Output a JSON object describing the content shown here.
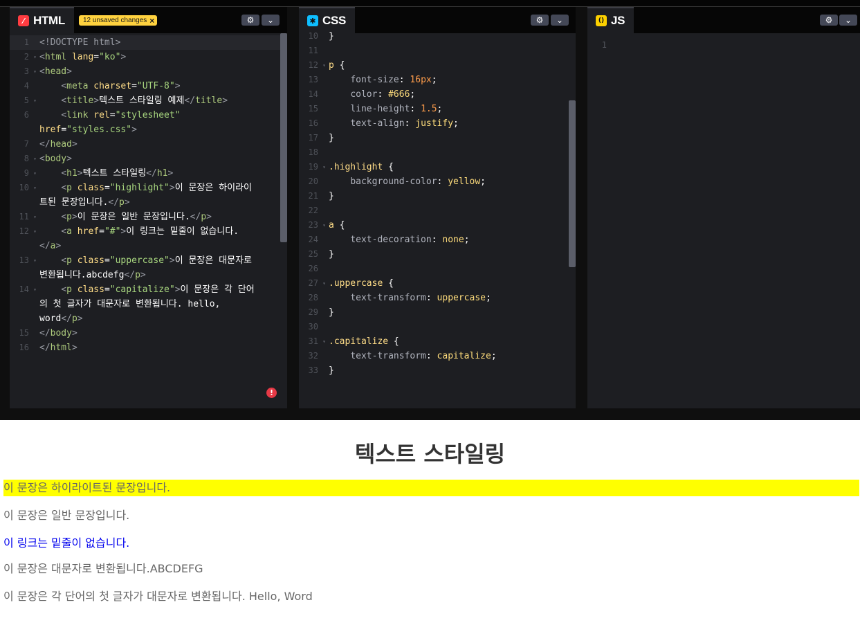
{
  "html_panel": {
    "tab_label": "HTML",
    "tab_icon": "slash-icon",
    "tab_color": "#ff3c41",
    "unsaved_badge": "12 unsaved changes",
    "lines": [
      {
        "n": "1",
        "fold": false,
        "segs": [
          [
            "br",
            "<!DOCTYPE html>"
          ]
        ]
      },
      {
        "n": "2",
        "fold": true,
        "segs": [
          [
            "br",
            "<"
          ],
          [
            "tg",
            "html"
          ],
          [
            "wt",
            " "
          ],
          [
            "at",
            "lang"
          ],
          [
            "wt",
            "="
          ],
          [
            "st",
            "\"ko\""
          ],
          [
            "br",
            ">"
          ]
        ]
      },
      {
        "n": "3",
        "fold": true,
        "segs": [
          [
            "br",
            "<"
          ],
          [
            "tg",
            "head"
          ],
          [
            "br",
            ">"
          ]
        ]
      },
      {
        "n": "4",
        "fold": false,
        "segs": [
          [
            "wt",
            "    "
          ],
          [
            "br",
            "<"
          ],
          [
            "tg",
            "meta"
          ],
          [
            "wt",
            " "
          ],
          [
            "at",
            "charset"
          ],
          [
            "wt",
            "="
          ],
          [
            "st",
            "\"UTF-8\""
          ],
          [
            "br",
            ">"
          ]
        ]
      },
      {
        "n": "5",
        "fold": true,
        "segs": [
          [
            "wt",
            "    "
          ],
          [
            "br",
            "<"
          ],
          [
            "tg",
            "title"
          ],
          [
            "br",
            ">"
          ],
          [
            "wt",
            "텍스트 스타일링 예제"
          ],
          [
            "br",
            "</"
          ],
          [
            "tg",
            "title"
          ],
          [
            "br",
            ">"
          ]
        ]
      },
      {
        "n": "6",
        "fold": false,
        "segs": [
          [
            "wt",
            "    "
          ],
          [
            "br",
            "<"
          ],
          [
            "tg",
            "link"
          ],
          [
            "wt",
            " "
          ],
          [
            "at",
            "rel"
          ],
          [
            "wt",
            "="
          ],
          [
            "st",
            "\"stylesheet\""
          ]
        ]
      },
      {
        "n": "",
        "fold": false,
        "segs": [
          [
            "at",
            "href"
          ],
          [
            "wt",
            "="
          ],
          [
            "st",
            "\"styles.css\""
          ],
          [
            "br",
            ">"
          ]
        ]
      },
      {
        "n": "7",
        "fold": false,
        "segs": [
          [
            "br",
            "</"
          ],
          [
            "tg",
            "head"
          ],
          [
            "br",
            ">"
          ]
        ]
      },
      {
        "n": "8",
        "fold": true,
        "segs": [
          [
            "br",
            "<"
          ],
          [
            "tg",
            "body"
          ],
          [
            "br",
            ">"
          ]
        ]
      },
      {
        "n": "9",
        "fold": true,
        "segs": [
          [
            "wt",
            "    "
          ],
          [
            "br",
            "<"
          ],
          [
            "tg",
            "h1"
          ],
          [
            "br",
            ">"
          ],
          [
            "wt",
            "텍스트 스타일링"
          ],
          [
            "br",
            "</"
          ],
          [
            "tg",
            "h1"
          ],
          [
            "br",
            ">"
          ]
        ]
      },
      {
        "n": "10",
        "fold": true,
        "segs": [
          [
            "wt",
            "    "
          ],
          [
            "br",
            "<"
          ],
          [
            "tg",
            "p"
          ],
          [
            "wt",
            " "
          ],
          [
            "at",
            "class"
          ],
          [
            "wt",
            "="
          ],
          [
            "st",
            "\"highlight\""
          ],
          [
            "br",
            ">"
          ],
          [
            "wt",
            "이 문장은 하이라이"
          ]
        ]
      },
      {
        "n": "",
        "fold": false,
        "segs": [
          [
            "wt",
            "트된 문장입니다."
          ],
          [
            "br",
            "</"
          ],
          [
            "tg",
            "p"
          ],
          [
            "br",
            ">"
          ]
        ]
      },
      {
        "n": "11",
        "fold": true,
        "segs": [
          [
            "wt",
            "    "
          ],
          [
            "br",
            "<"
          ],
          [
            "tg",
            "p"
          ],
          [
            "br",
            ">"
          ],
          [
            "wt",
            "이 문장은 일반 문장입니다."
          ],
          [
            "br",
            "</"
          ],
          [
            "tg",
            "p"
          ],
          [
            "br",
            ">"
          ]
        ]
      },
      {
        "n": "12",
        "fold": true,
        "segs": [
          [
            "wt",
            "    "
          ],
          [
            "br",
            "<"
          ],
          [
            "tg",
            "a"
          ],
          [
            "wt",
            " "
          ],
          [
            "at",
            "href"
          ],
          [
            "wt",
            "="
          ],
          [
            "st",
            "\"#\""
          ],
          [
            "br",
            ">"
          ],
          [
            "wt",
            "이 링크는 밑줄이 없습니다."
          ]
        ]
      },
      {
        "n": "",
        "fold": false,
        "segs": [
          [
            "br",
            "</"
          ],
          [
            "tg",
            "a"
          ],
          [
            "br",
            ">"
          ]
        ]
      },
      {
        "n": "13",
        "fold": true,
        "segs": [
          [
            "wt",
            "    "
          ],
          [
            "br",
            "<"
          ],
          [
            "tg",
            "p"
          ],
          [
            "wt",
            " "
          ],
          [
            "at",
            "class"
          ],
          [
            "wt",
            "="
          ],
          [
            "st",
            "\"uppercase\""
          ],
          [
            "br",
            ">"
          ],
          [
            "wt",
            "이 문장은 대문자로"
          ]
        ]
      },
      {
        "n": "",
        "fold": false,
        "segs": [
          [
            "wt",
            "변환됩니다.abcdefg"
          ],
          [
            "br",
            "</"
          ],
          [
            "tg",
            "p"
          ],
          [
            "br",
            ">"
          ]
        ]
      },
      {
        "n": "14",
        "fold": true,
        "segs": [
          [
            "wt",
            "    "
          ],
          [
            "br",
            "<"
          ],
          [
            "tg",
            "p"
          ],
          [
            "wt",
            " "
          ],
          [
            "at",
            "class"
          ],
          [
            "wt",
            "="
          ],
          [
            "st",
            "\"capitalize\""
          ],
          [
            "br",
            ">"
          ],
          [
            "wt",
            "이 문장은 각 단어"
          ]
        ]
      },
      {
        "n": "",
        "fold": false,
        "segs": [
          [
            "wt",
            "의 첫 글자가 대문자로 변환됩니다. hello,"
          ]
        ]
      },
      {
        "n": "",
        "fold": false,
        "segs": [
          [
            "wt",
            "word"
          ],
          [
            "br",
            "</"
          ],
          [
            "tg",
            "p"
          ],
          [
            "br",
            ">"
          ]
        ]
      },
      {
        "n": "15",
        "fold": false,
        "segs": [
          [
            "br",
            "</"
          ],
          [
            "tg",
            "body"
          ],
          [
            "br",
            ">"
          ]
        ]
      },
      {
        "n": "16",
        "fold": false,
        "segs": [
          [
            "br",
            "</"
          ],
          [
            "tg",
            "html"
          ],
          [
            "br",
            ">"
          ]
        ]
      }
    ],
    "error_icon": "!"
  },
  "css_panel": {
    "tab_label": "CSS",
    "tab_icon": "asterisk-icon",
    "tab_color": "#0ebeff",
    "lines": [
      {
        "n": "10",
        "fold": false,
        "segs": [
          [
            "wt",
            "}"
          ]
        ]
      },
      {
        "n": "11",
        "fold": false,
        "segs": []
      },
      {
        "n": "12",
        "fold": true,
        "segs": [
          [
            "sel",
            "p"
          ],
          [
            "wt",
            " {"
          ]
        ]
      },
      {
        "n": "13",
        "fold": false,
        "segs": [
          [
            "wt",
            "    "
          ],
          [
            "pr",
            "font-size"
          ],
          [
            "wt",
            ": "
          ],
          [
            "nm",
            "16px"
          ],
          [
            "wt",
            ";"
          ]
        ]
      },
      {
        "n": "14",
        "fold": false,
        "segs": [
          [
            "wt",
            "    "
          ],
          [
            "pr",
            "color"
          ],
          [
            "wt",
            ": "
          ],
          [
            "vl",
            "#666"
          ],
          [
            "wt",
            ";"
          ]
        ]
      },
      {
        "n": "15",
        "fold": false,
        "segs": [
          [
            "wt",
            "    "
          ],
          [
            "pr",
            "line-height"
          ],
          [
            "wt",
            ": "
          ],
          [
            "nm",
            "1.5"
          ],
          [
            "wt",
            ";"
          ]
        ]
      },
      {
        "n": "16",
        "fold": false,
        "segs": [
          [
            "wt",
            "    "
          ],
          [
            "pr",
            "text-align"
          ],
          [
            "wt",
            ": "
          ],
          [
            "vl",
            "justify"
          ],
          [
            "wt",
            ";"
          ]
        ]
      },
      {
        "n": "17",
        "fold": false,
        "segs": [
          [
            "wt",
            "}"
          ]
        ]
      },
      {
        "n": "18",
        "fold": false,
        "segs": []
      },
      {
        "n": "19",
        "fold": true,
        "segs": [
          [
            "sel",
            ".highlight"
          ],
          [
            "wt",
            " {"
          ]
        ]
      },
      {
        "n": "20",
        "fold": false,
        "segs": [
          [
            "wt",
            "    "
          ],
          [
            "pr",
            "background-color"
          ],
          [
            "wt",
            ": "
          ],
          [
            "vl",
            "yellow"
          ],
          [
            "wt",
            ";"
          ]
        ]
      },
      {
        "n": "21",
        "fold": false,
        "segs": [
          [
            "wt",
            "}"
          ]
        ]
      },
      {
        "n": "22",
        "fold": false,
        "segs": []
      },
      {
        "n": "23",
        "fold": true,
        "segs": [
          [
            "sel",
            "a"
          ],
          [
            "wt",
            " {"
          ]
        ]
      },
      {
        "n": "24",
        "fold": false,
        "segs": [
          [
            "wt",
            "    "
          ],
          [
            "pr",
            "text-decoration"
          ],
          [
            "wt",
            ": "
          ],
          [
            "vl",
            "none"
          ],
          [
            "wt",
            ";"
          ]
        ]
      },
      {
        "n": "25",
        "fold": false,
        "segs": [
          [
            "wt",
            "}"
          ]
        ]
      },
      {
        "n": "26",
        "fold": false,
        "segs": []
      },
      {
        "n": "27",
        "fold": true,
        "segs": [
          [
            "sel",
            ".uppercase"
          ],
          [
            "wt",
            " {"
          ]
        ]
      },
      {
        "n": "28",
        "fold": false,
        "segs": [
          [
            "wt",
            "    "
          ],
          [
            "pr",
            "text-transform"
          ],
          [
            "wt",
            ": "
          ],
          [
            "vl",
            "uppercase"
          ],
          [
            "wt",
            ";"
          ]
        ]
      },
      {
        "n": "29",
        "fold": false,
        "segs": [
          [
            "wt",
            "}"
          ]
        ]
      },
      {
        "n": "30",
        "fold": false,
        "segs": []
      },
      {
        "n": "31",
        "fold": true,
        "segs": [
          [
            "sel",
            ".capitalize"
          ],
          [
            "wt",
            " {"
          ]
        ]
      },
      {
        "n": "32",
        "fold": false,
        "segs": [
          [
            "wt",
            "    "
          ],
          [
            "pr",
            "text-transform"
          ],
          [
            "wt",
            ": "
          ],
          [
            "vl",
            "capitalize"
          ],
          [
            "wt",
            ";"
          ]
        ]
      },
      {
        "n": "33",
        "fold": false,
        "segs": [
          [
            "wt",
            "}"
          ]
        ]
      }
    ]
  },
  "js_panel": {
    "tab_label": "JS",
    "tab_icon": "parentheses-icon",
    "tab_color": "#fcd000",
    "lines": [
      {
        "n": "1",
        "fold": false,
        "segs": []
      }
    ]
  },
  "settings_icon": "gear-icon",
  "collapse_icon": "chevron-down-icon",
  "preview": {
    "h1": "텍스트 스타일링",
    "highlight": "이 문장은 하이라이트된 문장입니다.",
    "normal": "이 문장은 일반 문장입니다.",
    "link": "이 링크는 밑줄이 없습니다.",
    "uppercase": "이 문장은 대문자로 변환됩니다.ABCDEFG",
    "capitalize": "이 문장은 각 단어의 첫 글자가 대문자로 변환됩니다. Hello, Word",
    "highlight_color": "#ffff00",
    "link_color": "#0000ee",
    "text_color": "#666666"
  }
}
